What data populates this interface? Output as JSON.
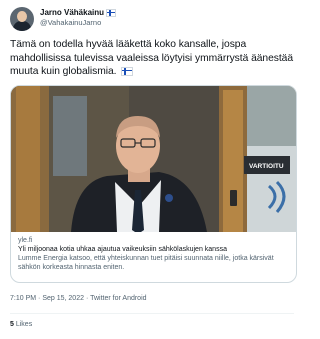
{
  "author": {
    "display_name": "Jarno Vähäkainu",
    "flag": "finland-flag-icon",
    "handle": "@VahakainuJarno"
  },
  "tweet": {
    "text": "Tämä on todella hyvää lääkettä koko kansalle, jospa mahdollisissa tulevissa vaaleissa löytyisi ymmärrystä äänestää muuta kuin globalismia.",
    "trailing_emoji": "finland-flag-icon"
  },
  "card": {
    "image_sign_text": "VARTIOITU",
    "domain": "yle.fi",
    "title": "Yli miljoonaa kotia uhkaa ajautua vaikeuksiin sähkölaskujen kanssa",
    "description": "Lumme Energia katsoo, että yhteiskunnan tuet pitäisi suunnata niille, jotka kärsivät sähkön korkeasta hinnasta eniten."
  },
  "meta": {
    "time": "7:10 PM",
    "date": "Sep 15, 2022",
    "client": "Twitter for Android",
    "separator": "·"
  },
  "stats": {
    "likes_count": "5",
    "likes_label": "Likes"
  },
  "colors": {
    "text": "#0f1419",
    "secondary": "#536471",
    "border": "#cfd9de",
    "flag_blue": "#1a4fb8"
  }
}
